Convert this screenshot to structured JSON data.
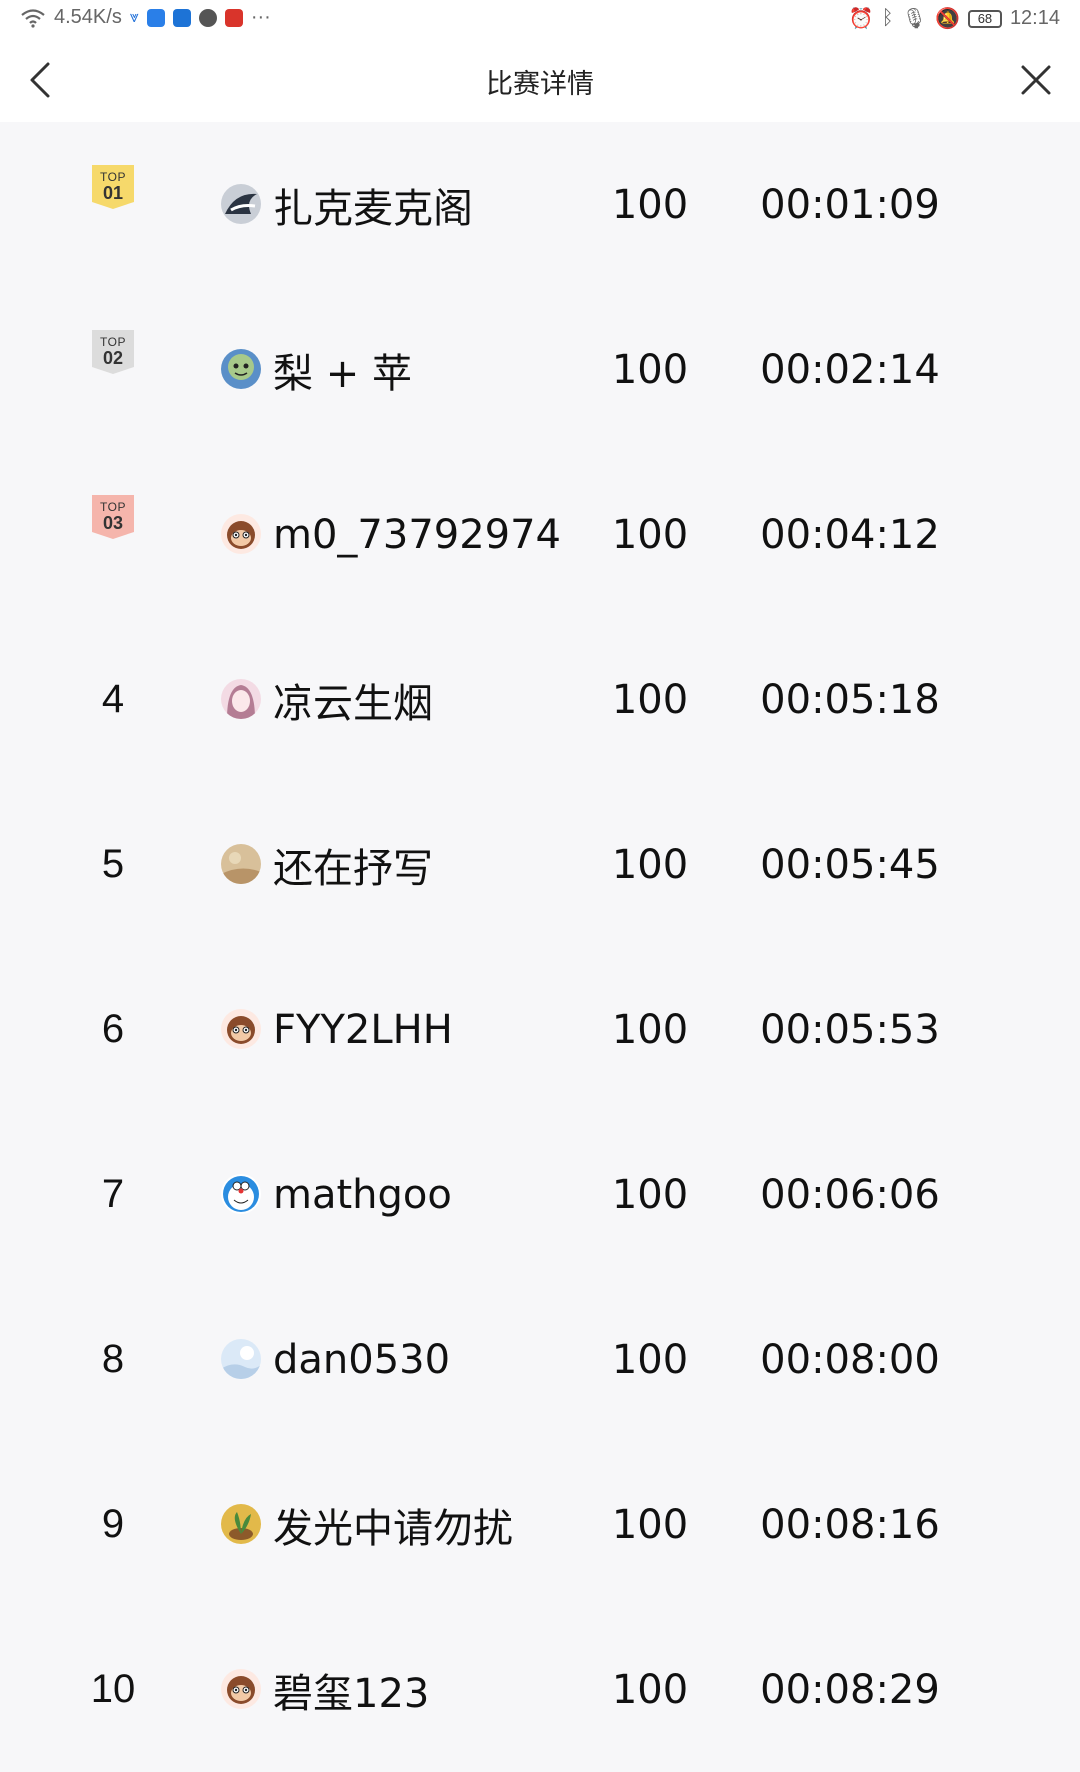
{
  "status_bar": {
    "network_speed": "4.54K/s",
    "more": "···",
    "battery": "68",
    "time": "12:14"
  },
  "nav": {
    "title": "比赛详情"
  },
  "badge_prefix": "TOP",
  "badge_colors": {
    "gold": "#f6d96b",
    "silver": "#dcdcdc",
    "bronze": "#f5b5ac"
  },
  "rows": [
    {
      "rank": "1",
      "badge": "01",
      "badge_color": "#f6d96b",
      "avatar": "eagle-avatar",
      "name": "扎克麦克阁",
      "score": "100",
      "time": "00:01:09"
    },
    {
      "rank": "2",
      "badge": "02",
      "badge_color": "#dcdcdc",
      "avatar": "cartoon-face-avatar",
      "name": "梨 + 苹",
      "score": "100",
      "time": "00:02:14"
    },
    {
      "rank": "3",
      "badge": "03",
      "badge_color": "#f5b5ac",
      "avatar": "monkey-avatar",
      "name": "m0_73792974",
      "score": "100",
      "time": "00:04:12"
    },
    {
      "rank": "4",
      "badge": "",
      "badge_color": "",
      "avatar": "anime-girl-avatar",
      "name": "凉云生烟",
      "score": "100",
      "time": "00:05:18"
    },
    {
      "rank": "5",
      "badge": "",
      "badge_color": "",
      "avatar": "landscape-avatar",
      "name": "还在抒写",
      "score": "100",
      "time": "00:05:45"
    },
    {
      "rank": "6",
      "badge": "",
      "badge_color": "",
      "avatar": "monkey-avatar",
      "name": "FYY2LHH",
      "score": "100",
      "time": "00:05:53"
    },
    {
      "rank": "7",
      "badge": "",
      "badge_color": "",
      "avatar": "doraemon-avatar",
      "name": "mathgoo",
      "score": "100",
      "time": "00:06:06"
    },
    {
      "rank": "8",
      "badge": "",
      "badge_color": "",
      "avatar": "sky-avatar",
      "name": "dan0530",
      "score": "100",
      "time": "00:08:00"
    },
    {
      "rank": "9",
      "badge": "",
      "badge_color": "",
      "avatar": "plant-avatar",
      "name": "发光中请勿扰",
      "score": "100",
      "time": "00:08:16"
    },
    {
      "rank": "10",
      "badge": "",
      "badge_color": "",
      "avatar": "monkey-avatar",
      "name": "碧玺123",
      "score": "100",
      "time": "00:08:29"
    }
  ]
}
